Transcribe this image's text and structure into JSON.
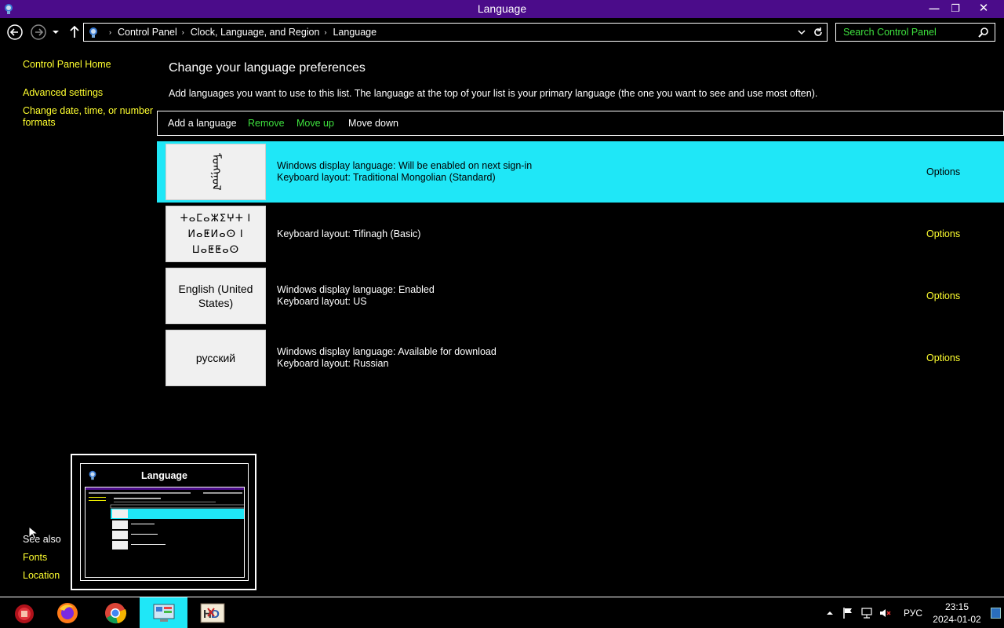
{
  "window": {
    "title": "Language",
    "minimize_label": "—",
    "maximize_label": "❐",
    "close_label": "✕"
  },
  "address": {
    "crumbs": [
      "Control Panel",
      "Clock, Language, and Region",
      "Language"
    ],
    "separator": "›"
  },
  "search": {
    "placeholder": "Search Control Panel"
  },
  "sidebar": {
    "home": "Control Panel Home",
    "advanced": "Advanced settings",
    "date_formats": "Change date, time, or number formats",
    "see_also": "See also",
    "fonts": "Fonts",
    "location": "Location"
  },
  "main": {
    "title": "Change your language preferences",
    "description": "Add languages you want to use to this list. The language at the top of your list is your primary language (the one you want to see and use most often).",
    "toolbar": {
      "add": "Add a language",
      "remove": "Remove",
      "move_up": "Move up",
      "move_down": "Move down"
    },
    "languages": [
      {
        "tile": "ᠮᠣᠩᠭᠣᠯ",
        "line1": "Windows display language: Will be enabled on next sign-in",
        "line2": "Keyboard layout: Traditional Mongolian (Standard)",
        "options": "Options"
      },
      {
        "tile": "ⵜⴰⵎⴰⵣⵉⵖⵜ ⵏ ⵍⴰⵟⵍⴰⵙ ⵏ ⵡⴰⵟⵟⴰⵙ",
        "line1": "Keyboard layout: Tifinagh (Basic)",
        "options": "Options"
      },
      {
        "tile": "English (United States)",
        "line1": "Windows display language: Enabled",
        "line2": "Keyboard layout: US",
        "options": "Options"
      },
      {
        "tile": "русский",
        "line1": "Windows display language: Available for download",
        "line2": "Keyboard layout: Russian",
        "options": "Options"
      }
    ]
  },
  "thumbnail": {
    "title": "Language"
  },
  "taskbar": {
    "apps": [
      "start-orb-icon",
      "firefox-icon",
      "chrome-icon",
      "control-panel-icon",
      "hxd-icon"
    ],
    "tray_lang": "РУС",
    "time": "23:15",
    "date": "2024-01-02"
  },
  "colors": {
    "title_bar": "#4b0c8a",
    "selection": "#1fe7f7",
    "link_yellow": "#ffff2f",
    "link_green": "#3ee13e"
  }
}
